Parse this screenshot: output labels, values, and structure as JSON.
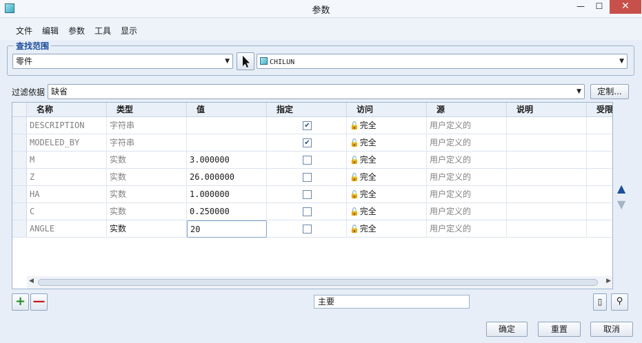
{
  "window": {
    "title": "参数",
    "controls": {
      "minimize": "—",
      "maximize": "☐",
      "close": "✕"
    }
  },
  "menu": [
    "文件",
    "编辑",
    "参数",
    "工具",
    "显示"
  ],
  "search_scope": {
    "legend": "查找范围",
    "type_value": "零件",
    "model_value": "CHILUN"
  },
  "filter": {
    "label": "过滤依据",
    "value": "缺省",
    "customize_label": "定制..."
  },
  "table": {
    "columns": [
      "名称",
      "类型",
      "值",
      "指定",
      "访问",
      "源",
      "说明",
      "受限"
    ],
    "rows": [
      {
        "name": "DESCRIPTION",
        "type": "字符串",
        "value": "",
        "designated": true,
        "access": "完全",
        "source": "用户定义的"
      },
      {
        "name": "MODELED_BY",
        "type": "字符串",
        "value": "",
        "designated": true,
        "access": "完全",
        "source": "用户定义的"
      },
      {
        "name": "M",
        "type": "实数",
        "value": "3.000000",
        "designated": false,
        "access": "完全",
        "source": "用户定义的"
      },
      {
        "name": "Z",
        "type": "实数",
        "value": "26.000000",
        "designated": false,
        "access": "完全",
        "source": "用户定义的"
      },
      {
        "name": "HA",
        "type": "实数",
        "value": "1.000000",
        "designated": false,
        "access": "完全",
        "source": "用户定义的"
      },
      {
        "name": "C",
        "type": "实数",
        "value": "0.250000",
        "designated": false,
        "access": "完全",
        "source": "用户定义的"
      },
      {
        "name": "ANGLE",
        "type": "实数",
        "value": "20",
        "designated": false,
        "access": "完全",
        "source": "用户定义的"
      }
    ]
  },
  "bottom": {
    "add_symbol": "+",
    "remove_symbol": "—",
    "main_value": "主要",
    "ok_label": "确定",
    "reset_label": "重置",
    "cancel_label": "取消"
  }
}
